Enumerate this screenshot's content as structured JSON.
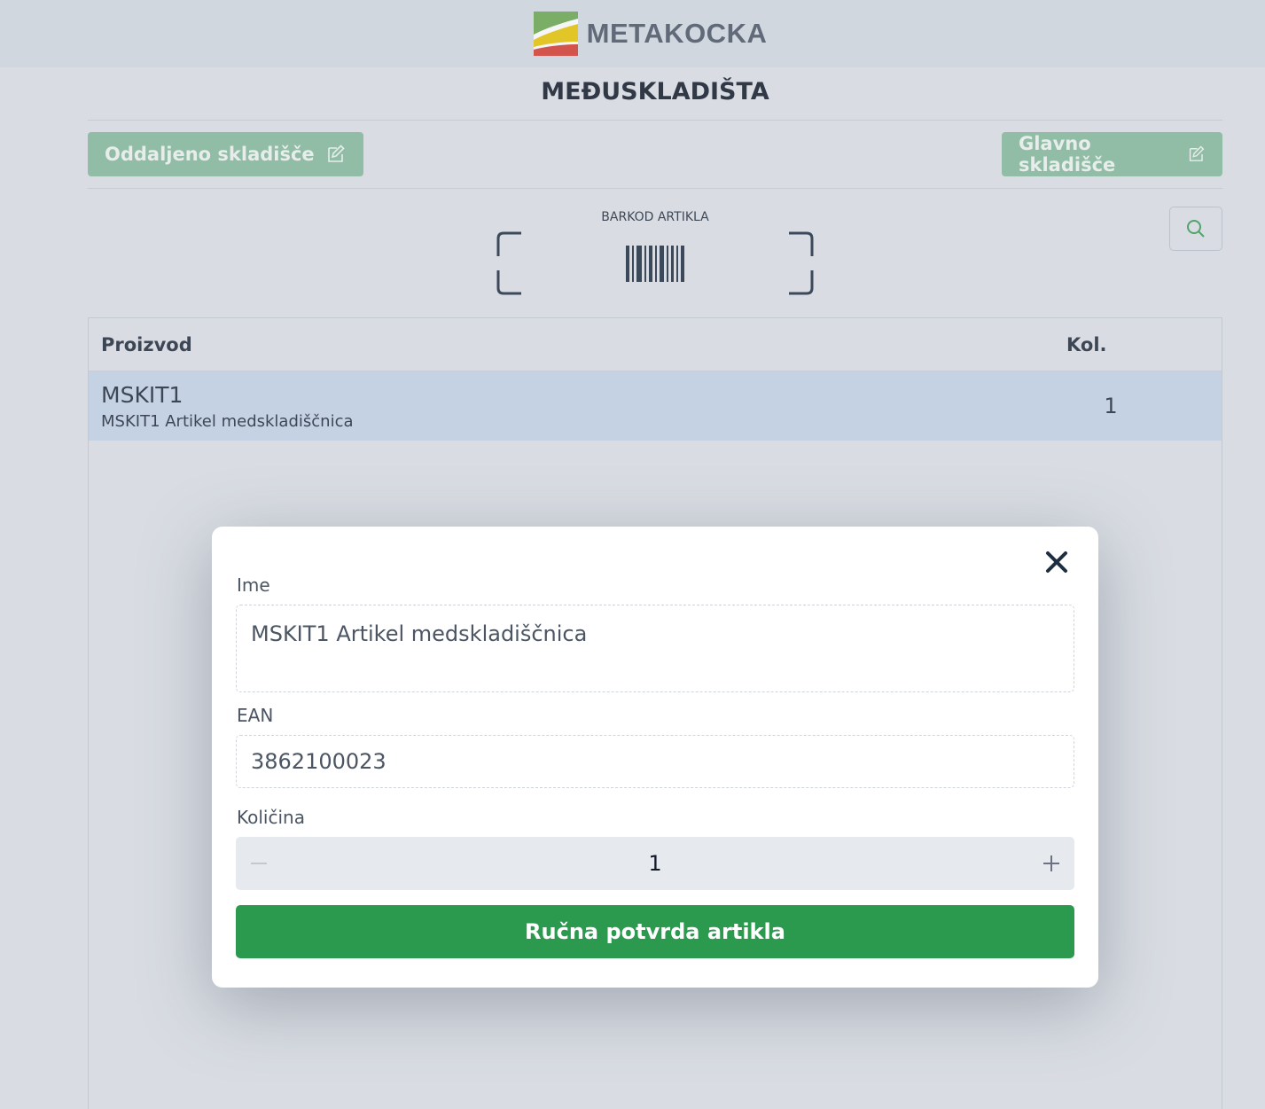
{
  "header": {
    "brand": "METAKOCKA",
    "page_title": "MEĐUSKLADIŠTA"
  },
  "warehouses": {
    "remote_label": "Oddaljeno skladišče",
    "main_label": "Glavno skladišče"
  },
  "scanner": {
    "label": "BARKOD ARTIKLA"
  },
  "table": {
    "col_product": "Proizvod",
    "col_qty": "Kol.",
    "rows": [
      {
        "code": "MSKIT1",
        "name": "MSKIT1 Artikel medskladiščnica",
        "qty": "1"
      }
    ]
  },
  "modal": {
    "name_label": "Ime",
    "name_value": "MSKIT1 Artikel medskladiščnica",
    "ean_label": "EAN",
    "ean_value": "3862100023",
    "qty_label": "Količina",
    "qty_value": "1",
    "confirm_label": "Ručna potvrda artikla"
  },
  "colors": {
    "accent_green": "#2b9a4e",
    "muted_green": "#86b99a",
    "selected_row": "#c5d4e6"
  },
  "icons": [
    "logo-icon",
    "edit-icon",
    "barcode-icon",
    "search-icon",
    "close-icon",
    "minus-icon",
    "plus-icon"
  ]
}
